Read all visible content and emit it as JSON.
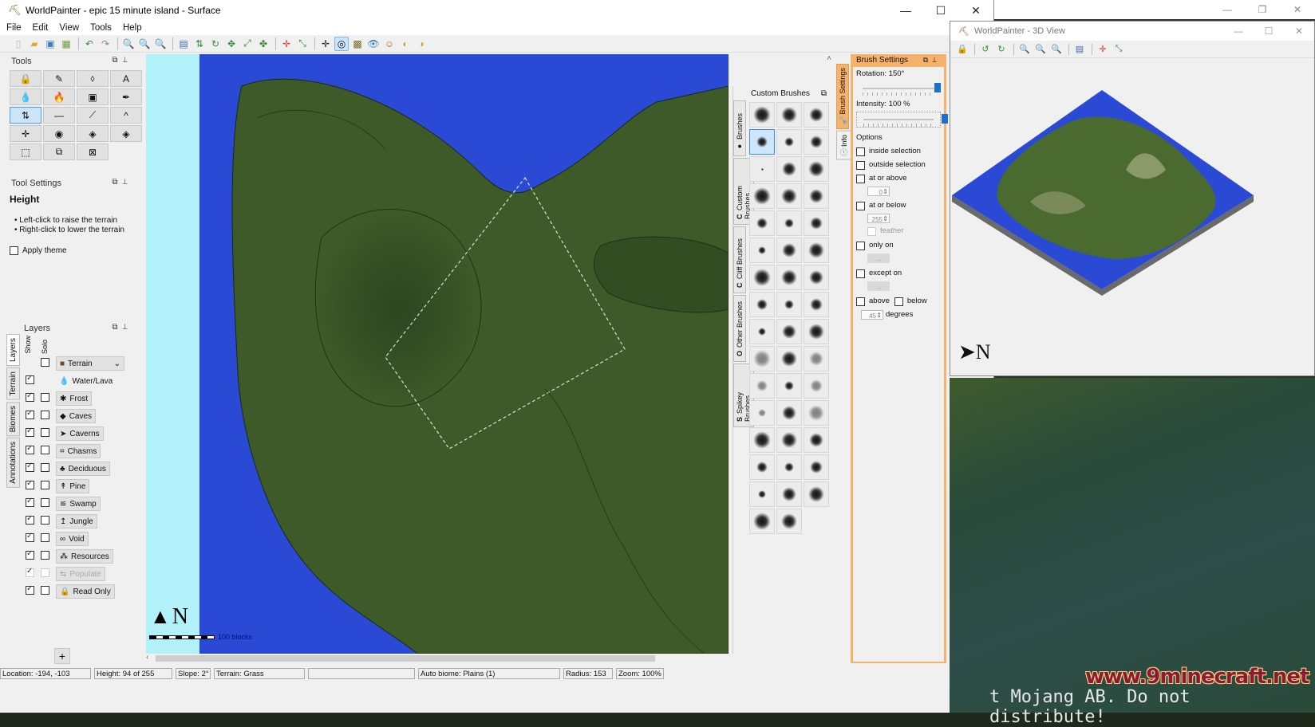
{
  "main_window": {
    "title": "WorldPainter - epic 15 minute island - Surface",
    "controls": {
      "minimize": "—",
      "maximize": "☐",
      "close": "✕"
    }
  },
  "menu": [
    "File",
    "Edit",
    "View",
    "Tools",
    "Help"
  ],
  "toolbar": {
    "buttons": [
      "new-world",
      "open-world",
      "save-world",
      "export-image",
      "undo",
      "redo",
      "zoom-out",
      "zoom-reset",
      "zoom-in",
      "dimension-properties",
      "change-height",
      "rotate",
      "shift",
      "scale",
      "add-layer",
      "mark-spawn",
      "reset-view",
      "move-to-origin",
      "move-to-spawn",
      "view-options",
      "show-3d",
      "players",
      "rotate-light-left",
      "rotate-light-right"
    ]
  },
  "tools_panel": {
    "title": "Tools",
    "tools": [
      {
        "name": "lock-tool",
        "glyph": "🔒",
        "selected": false
      },
      {
        "name": "pencil-tool",
        "glyph": "✎",
        "selected": false
      },
      {
        "name": "flood-tool",
        "glyph": "⬨",
        "selected": false
      },
      {
        "name": "text-tool",
        "glyph": "A",
        "selected": false
      },
      {
        "name": "flood-water-tool",
        "glyph": "💧",
        "selected": false
      },
      {
        "name": "flood-lava-tool",
        "glyph": "🔥",
        "selected": false
      },
      {
        "name": "sponge-tool",
        "glyph": "▣",
        "selected": false
      },
      {
        "name": "eyedropper-tool",
        "glyph": "✒",
        "selected": false
      },
      {
        "name": "raise-lower-tool",
        "glyph": "⇅",
        "selected": true
      },
      {
        "name": "flatten-tool",
        "glyph": "—",
        "selected": false
      },
      {
        "name": "smooth-tool",
        "glyph": "⟋",
        "selected": false
      },
      {
        "name": "raise-mountain-tool",
        "glyph": "^",
        "selected": false
      },
      {
        "name": "set-spawn-tool",
        "glyph": "✛",
        "selected": false
      },
      {
        "name": "raise-pyramid-tool",
        "glyph": "◉",
        "selected": false
      },
      {
        "name": "raise-rotated-pyramid-tool",
        "glyph": "◈",
        "selected": false
      },
      {
        "name": "raise-rotated-pyramid-2-tool",
        "glyph": "◈",
        "selected": false
      },
      {
        "name": "select-tool",
        "glyph": "⬚",
        "selected": false
      },
      {
        "name": "copy-selection-tool",
        "glyph": "⧉",
        "selected": false
      },
      {
        "name": "clear-selection-tool",
        "glyph": "⊠",
        "selected": false
      }
    ]
  },
  "tool_settings": {
    "title": "Tool Settings",
    "tool_name": "Height",
    "hints": [
      "Left-click to raise the terrain",
      "Right-click to lower the terrain"
    ],
    "apply_theme_label": "Apply theme",
    "apply_theme_checked": false
  },
  "layers_panel": {
    "title": "Layers",
    "side_tabs": [
      "Layers",
      "Terrain",
      "Biomes",
      "Annotations"
    ],
    "col_show": "Show",
    "col_solo": "Solo",
    "rows": [
      {
        "label": "Terrain",
        "icon": "■",
        "show": null,
        "solo": false,
        "dropdown": true
      },
      {
        "label": "Water/Lava",
        "icon": "💧",
        "show": true,
        "solo": null,
        "button": false
      },
      {
        "label": "Frost",
        "icon": "✱",
        "show": true,
        "solo": false
      },
      {
        "label": "Caves",
        "icon": "◆",
        "show": true,
        "solo": false
      },
      {
        "label": "Caverns",
        "icon": "➤",
        "show": true,
        "solo": false
      },
      {
        "label": "Chasms",
        "icon": "⌗",
        "show": true,
        "solo": false
      },
      {
        "label": "Deciduous",
        "icon": "♣",
        "show": true,
        "solo": false
      },
      {
        "label": "Pine",
        "icon": "↟",
        "show": true,
        "solo": false
      },
      {
        "label": "Swamp",
        "icon": "≌",
        "show": true,
        "solo": false
      },
      {
        "label": "Jungle",
        "icon": "↥",
        "show": true,
        "solo": false
      },
      {
        "label": "Void",
        "icon": "∞",
        "show": true,
        "solo": false
      },
      {
        "label": "Resources",
        "icon": "⁂",
        "show": true,
        "solo": false
      },
      {
        "label": "Populate",
        "icon": "⇆",
        "show": true,
        "solo": false,
        "disabled": true
      },
      {
        "label": "Read Only",
        "icon": "🔒",
        "show": true,
        "solo": false
      }
    ],
    "add_label": "+"
  },
  "map": {
    "compass_label": "N",
    "scale_label": "100 blocks"
  },
  "brushes_panel": {
    "title": "Custom Brushes",
    "side_tabs": [
      "Brushes",
      "Custom Brushes",
      "Cliff Brushes",
      "Other Brushes",
      "Spikey Brushes"
    ],
    "side_tab_letters": [
      "●",
      "C",
      "C",
      "O",
      "S"
    ],
    "selected_index": 3,
    "brush_count": 47
  },
  "brush_settings": {
    "title": "Brush Settings",
    "side_tabs": [
      "Brush Settings",
      "Info"
    ],
    "rotation_label": "Rotation: 150°",
    "rotation_value_deg": 150,
    "rotation_range": [
      -180,
      180
    ],
    "intensity_label": "Intensity: 100 %",
    "intensity_value_pct": 100,
    "options_label": "Options",
    "options": {
      "inside_selection": {
        "label": "inside selection",
        "checked": false
      },
      "outside_selection": {
        "label": "outside selection",
        "checked": false
      },
      "at_or_above": {
        "label": "at or above",
        "checked": false,
        "value": "0"
      },
      "at_or_below": {
        "label": "at or below",
        "checked": false,
        "value": "255"
      },
      "feather": {
        "label": "feather",
        "checked": false
      },
      "only_on": {
        "label": "only on",
        "checked": false,
        "button": "..."
      },
      "except_on": {
        "label": "except on",
        "checked": false,
        "button": "..."
      },
      "above": {
        "label": "above",
        "checked": false
      },
      "below": {
        "label": "below",
        "checked": false
      },
      "degrees": {
        "value": "45",
        "label": "degrees"
      }
    }
  },
  "status_bar": {
    "location": "Location: -194, -103",
    "height": "Height: 94 of 255",
    "slope": "Slope: 2°",
    "terrain": "Terrain: Grass",
    "blank": "",
    "biome": "Auto biome: Plains (1)",
    "radius": "Radius: 153",
    "zoom": "Zoom: 100%"
  },
  "window_3d": {
    "title": "WorldPainter - 3D View",
    "controls": {
      "minimize": "—",
      "maximize": "☐",
      "close": "✕"
    },
    "toolbar": [
      "always-on-top",
      "rotate-left",
      "rotate-right",
      "zoom-out",
      "zoom-reset",
      "zoom-in",
      "export-image",
      "reset-view",
      "move-to-spawn"
    ],
    "compass_label": "N"
  },
  "background_window": {
    "controls": {
      "minimize": "—",
      "restore": "❐",
      "close": "✕"
    }
  },
  "overlay": {
    "watermark": "www.9minecraft.net",
    "minecraft_notice": "t Mojang AB. Do not distribute!"
  },
  "colors": {
    "water": "#2a4ad6",
    "land": "#3d5a28",
    "edge": "#b2f0fa",
    "brush_settings_accent": "#f6b26b",
    "selection": "#cce4f7"
  }
}
